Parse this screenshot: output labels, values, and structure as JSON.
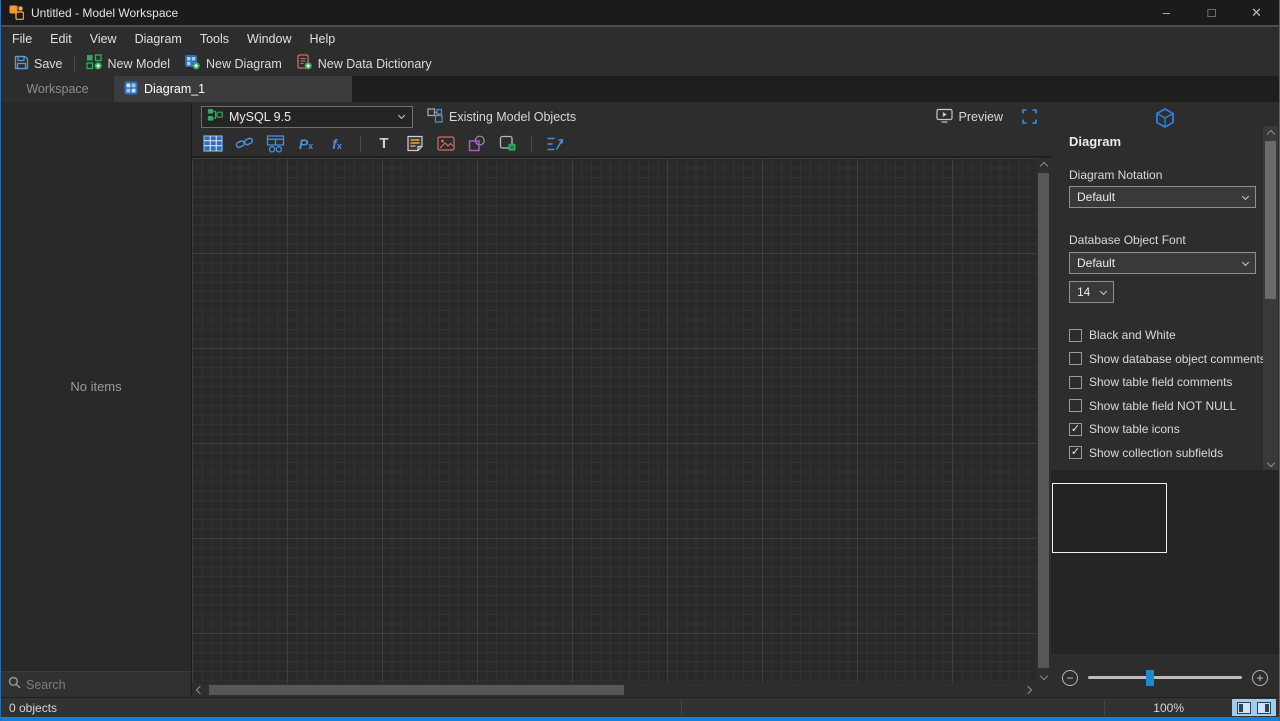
{
  "window": {
    "title": "Untitled - Model Workspace",
    "controls": {
      "minimize": "–",
      "maximize": "□",
      "close": "✕"
    }
  },
  "menu": {
    "items": [
      "File",
      "Edit",
      "View",
      "Diagram",
      "Tools",
      "Window",
      "Help"
    ]
  },
  "toolbar": {
    "save": "Save",
    "new_model": "New Model",
    "new_diagram": "New Diagram",
    "new_data_dictionary": "New Data Dictionary"
  },
  "tabs": [
    {
      "label": "Workspace",
      "active": false
    },
    {
      "label": "Diagram_1",
      "active": true
    }
  ],
  "canvas_toolbar": {
    "database": "MySQL 9.5",
    "existing_model_objects": "Existing Model Objects",
    "preview": "Preview"
  },
  "icons": {
    "procedure_glyph": "P",
    "procedure_sub": "x",
    "function_glyph": "f",
    "function_sub": "x",
    "text_tool_glyph": "T"
  },
  "left_panel": {
    "empty_text": "No items",
    "search_placeholder": "Search"
  },
  "right_panel": {
    "title": "Diagram",
    "notation_label": "Diagram Notation",
    "notation_value": "Default",
    "font_label": "Database Object Font",
    "font_value": "Default",
    "font_size": "14",
    "checkboxes": [
      {
        "label": "Black and White",
        "checked": false
      },
      {
        "label": "Show database object comments",
        "checked": false
      },
      {
        "label": "Show table field comments",
        "checked": false
      },
      {
        "label": "Show table field NOT NULL",
        "checked": false
      },
      {
        "label": "Show table icons",
        "checked": true
      },
      {
        "label": "Show collection subfields",
        "checked": true
      }
    ],
    "zoom_out": "−",
    "zoom_in": "+"
  },
  "status_bar": {
    "objects": "0 objects",
    "zoom": "100%"
  },
  "colors": {
    "accent_blue": "#1581d8",
    "slider_thumb": "#1e88d2",
    "toggle_highlight": "#9fcdf2",
    "icon_blue": "#4a90d9",
    "icon_green": "#2fae62",
    "icon_orange": "#ef9b30"
  }
}
